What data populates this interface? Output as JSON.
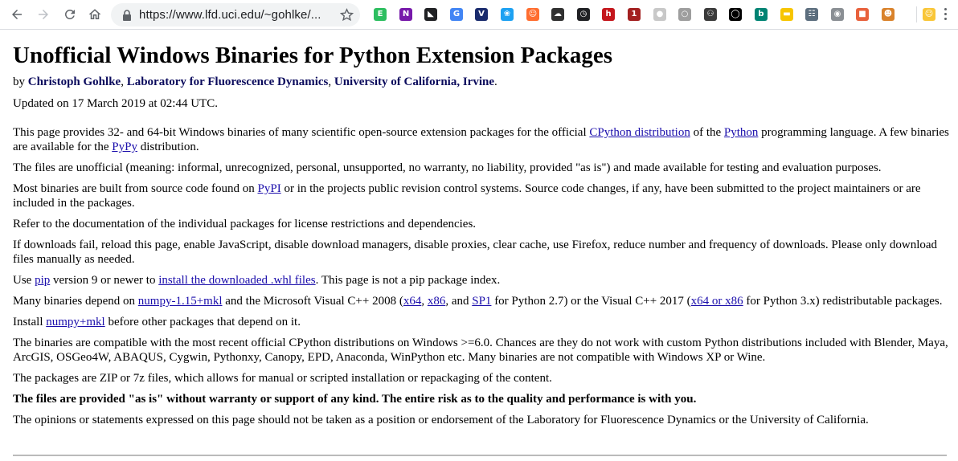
{
  "browser": {
    "url": "https://www.lfd.uci.edu/~gohlke/...",
    "extensions": [
      {
        "name": "evernote-ext-icon",
        "bg": "#2dbe60",
        "glyph": "E"
      },
      {
        "name": "onenote-ext-icon",
        "bg": "#7719aa",
        "glyph": "N"
      },
      {
        "name": "mailbird-ext-icon",
        "bg": "#202124",
        "glyph": "◣"
      },
      {
        "name": "translate-ext-icon",
        "bg": "#4285f4",
        "glyph": "G"
      },
      {
        "name": "vimeo-ext-icon",
        "bg": "#1a2b6d",
        "glyph": "V"
      },
      {
        "name": "feather-ext-icon",
        "bg": "#1da1f2",
        "glyph": "❀"
      },
      {
        "name": "chat-ext-icon",
        "bg": "#ff6d2f",
        "glyph": "☺"
      },
      {
        "name": "cloud-ext-icon",
        "bg": "#303030",
        "glyph": "☁"
      },
      {
        "name": "clock-ext-icon",
        "bg": "#202124",
        "glyph": "◷"
      },
      {
        "name": "hive-ext-icon",
        "bg": "#c4161c",
        "glyph": "h"
      },
      {
        "name": "shield-ext-icon",
        "bg": "#a32020",
        "glyph": "1"
      },
      {
        "name": "gray-circle-ext-icon",
        "bg": "#c8c8c8",
        "glyph": "●"
      },
      {
        "name": "lens-ext-icon",
        "bg": "#9e9e9e",
        "glyph": "○"
      },
      {
        "name": "mask-ext-icon",
        "bg": "#3a3a3a",
        "glyph": "⚇"
      },
      {
        "name": "ring-ext-icon",
        "bg": "#000000",
        "glyph": "◯"
      },
      {
        "name": "bing-ext-icon",
        "bg": "#008373",
        "glyph": "b"
      },
      {
        "name": "yellow-tag-ext-icon",
        "bg": "#f7c500",
        "glyph": "▬"
      },
      {
        "name": "grid-ext-icon",
        "bg": "#5c6e7e",
        "glyph": "☷"
      },
      {
        "name": "camera-ext-icon",
        "bg": "#8a8f94",
        "glyph": "◉"
      },
      {
        "name": "file-ext-icon",
        "bg": "#e8613c",
        "glyph": "■"
      },
      {
        "name": "avatar-ext-icon",
        "bg": "#d9822b",
        "glyph": "☻"
      },
      {
        "name": "emoji-ext-icon",
        "bg": "#f9c638",
        "glyph": "☺"
      }
    ]
  },
  "page": {
    "title": "Unofficial Windows Binaries for Python Extension Packages",
    "byline": {
      "prefix": "by ",
      "author": "Christoph Gohlke",
      "sep1": ", ",
      "lab": "Laboratory for Fluorescence Dynamics",
      "sep2": ", ",
      "university": "University of California, Irvine",
      "suffix": "."
    },
    "updated": "Updated on 17 March 2019 at 02:44 UTC.",
    "paragraphs": {
      "p1": {
        "t1": "This page provides 32- and 64-bit Windows binaries of many scientific open-source extension packages for the official ",
        "link_cpython": "CPython distribution",
        "t2": " of the ",
        "link_python": "Python",
        "t3": " programming language. A few binaries are available for the ",
        "link_pypy": "PyPy",
        "t4": " distribution."
      },
      "p2": "The files are unofficial (meaning: informal, unrecognized, personal, unsupported, no warranty, no liability, provided \"as is\") and made available for testing and evaluation purposes.",
      "p3": {
        "t1": "Most binaries are built from source code found on ",
        "link_pypi": "PyPI",
        "t2": " or in the projects public revision control systems. Source code changes, if any, have been submitted to the project maintainers or are included in the packages."
      },
      "p4": "Refer to the documentation of the individual packages for license restrictions and dependencies.",
      "p5": "If downloads fail, reload this page, enable JavaScript, disable download managers, disable proxies, clear cache, use Firefox, reduce number and frequency of downloads. Please only download files manually as needed.",
      "p6": {
        "t1": "Use ",
        "link_pip": "pip",
        "t2": " version 9 or newer to ",
        "link_install": "install the downloaded .whl files",
        "t3": ". This page is not a pip package index."
      },
      "p7": {
        "t1": "Many binaries depend on ",
        "link_numpy": "numpy-1.15+mkl",
        "t2": " and the Microsoft Visual C++ 2008 (",
        "link_x64": "x64",
        "t3": ", ",
        "link_x86": "x86",
        "t4": ", and ",
        "link_sp1": "SP1",
        "t5": " for Python 2.7) or the Visual C++ 2017 (",
        "link_x64x86": "x64 or x86",
        "t6": " for Python 3.x) redistributable packages."
      },
      "p8": {
        "t1": "Install ",
        "link_numpy": "numpy+mkl",
        "t2": " before other packages that depend on it."
      },
      "p9": "The binaries are compatible with the most recent official CPython distributions on Windows >=6.0. Chances are they do not work with custom Python distributions included with Blender, Maya, ArcGIS, OSGeo4W, ABAQUS, Cygwin, Pythonxy, Canopy, EPD, Anaconda, WinPython etc. Many binaries are not compatible with Windows XP or Wine.",
      "p10": "The packages are ZIP or 7z files, which allows for manual or scripted installation or repackaging of the content.",
      "p11": "The files are provided \"as is\" without warranty or support of any kind. The entire risk as to the quality and performance is with you.",
      "p12": "The opinions or statements expressed on this page should not be taken as a position or endorsement of the Laboratory for Fluorescence Dynamics or the University of California."
    }
  }
}
